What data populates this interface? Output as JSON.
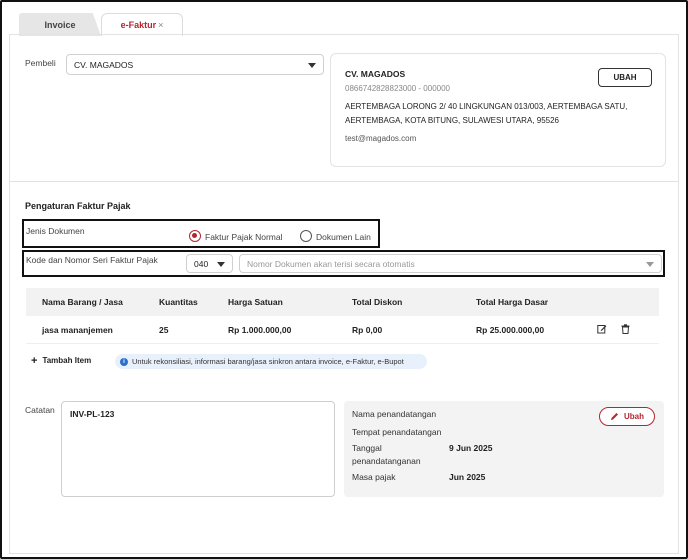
{
  "tabs": [
    {
      "label": "Invoice"
    },
    {
      "label": "e-Faktur",
      "close": "×"
    }
  ],
  "buyer": {
    "label": "Pembeli",
    "selected": "CV. MAGADOS",
    "card": {
      "name": "CV. MAGADOS",
      "tax_id": "0866742828823000 - 000000",
      "address_line1": "AERTEMBAGA LORONG 2/ 40 LINGKUNGAN 013/003, AERTEMBAGA SATU,",
      "address_line2": "AERTEMBAGA, KOTA BITUNG, SULAWESI UTARA, 95526",
      "email": "test@magados.com",
      "edit_label": "UBAH"
    }
  },
  "tax_settings": {
    "section_title": "Pengaturan Faktur Pajak",
    "doc_type_label": "Jenis Dokumen",
    "doc_type_options": [
      "Faktur Pajak Normal",
      "Dokumen Lain"
    ],
    "doc_type_selected": "Faktur Pajak Normal",
    "serial_label": "Kode dan Nomor Seri Faktur Pajak",
    "serial_code": "040",
    "serial_placeholder": "Nomor Dokumen akan terisi secara otomatis"
  },
  "items_table": {
    "headers": [
      "Nama Barang / Jasa",
      "Kuantitas",
      "Harga Satuan",
      "Total Diskon",
      "Total Harga Dasar"
    ],
    "rows": [
      {
        "name": "jasa mananjemen",
        "qty": "25",
        "unit_price": "Rp 1.000.000,00",
        "discount": "Rp 0,00",
        "total": "Rp 25.000.000,00"
      }
    ],
    "add_label": "Tambah Item",
    "info_text": "Untuk rekonsiliasi, informasi barang/jasa sinkron antara invoice, e-Faktur, e-Bupot"
  },
  "notes": {
    "label": "Catatan",
    "value": "INV-PL-123"
  },
  "signature": {
    "signer_name_label": "Nama penandatangan",
    "signer_place_label": "Tempat penandatangan",
    "sign_date_label_1": "Tanggal",
    "sign_date_label_2": "penandatanganan",
    "sign_date": "9 Jun 2025",
    "tax_period_label": "Masa pajak",
    "tax_period": "Jun 2025",
    "edit_label": "Ubah"
  },
  "colors": {
    "accent": "#b3262e",
    "info": "#2a6fc9",
    "header_bg": "#f2f2f2"
  },
  "icons": [
    "close-icon",
    "chevron-down-icon",
    "plus-icon",
    "info-icon",
    "edit-icon",
    "trash-icon",
    "pencil-icon"
  ]
}
